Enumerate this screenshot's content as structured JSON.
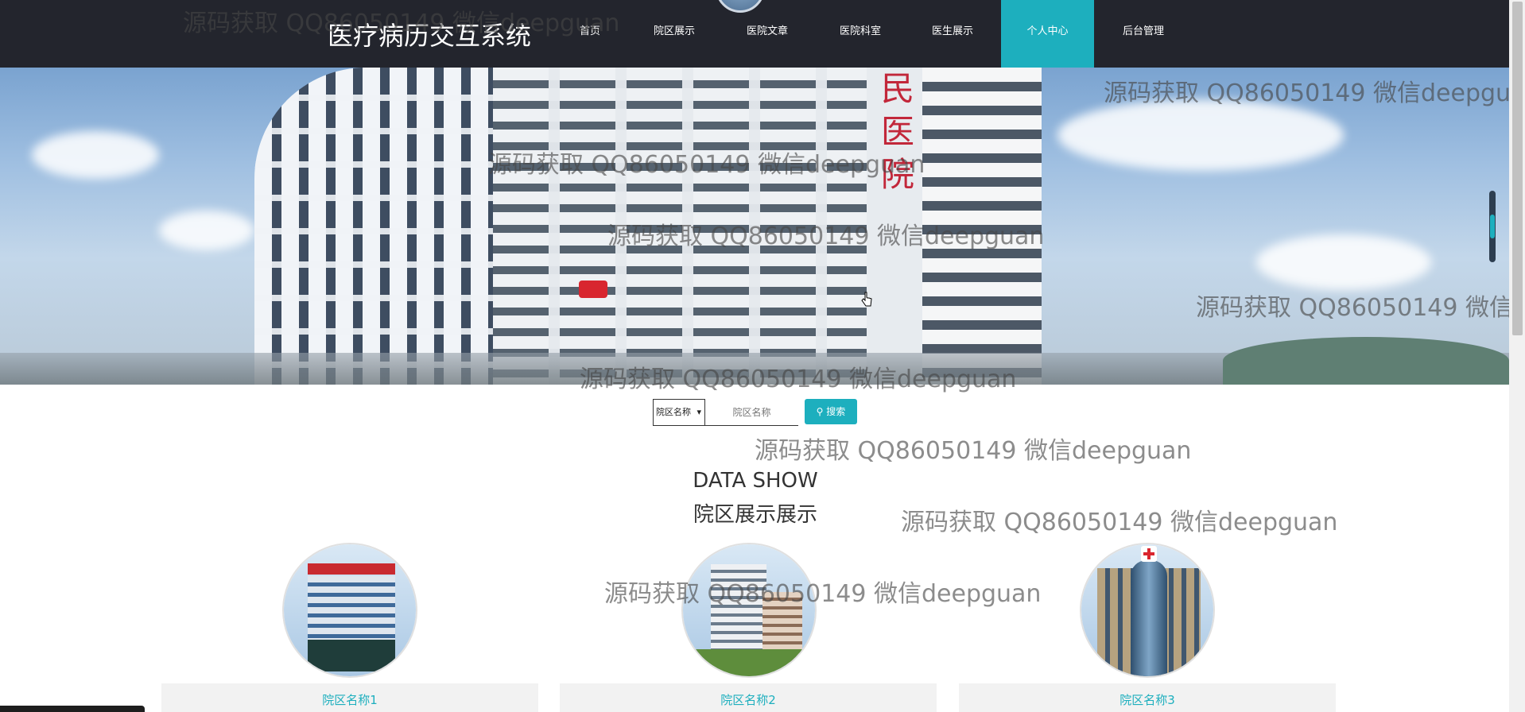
{
  "nav": {
    "site_title": "医疗病历交互系统",
    "items": [
      {
        "label": "首页"
      },
      {
        "label": "院区展示"
      },
      {
        "label": "医院文章"
      },
      {
        "label": "医院科室"
      },
      {
        "label": "医生展示"
      },
      {
        "label": "个人中心",
        "active": true
      },
      {
        "label": "后台管理"
      }
    ]
  },
  "hero": {
    "sign_text": "民医院"
  },
  "search": {
    "select_value": "院区名称",
    "input_placeholder": "院区名称",
    "button_label": "搜索"
  },
  "section": {
    "title_en": "DATA SHOW",
    "title_cn": "院区展示展示"
  },
  "cards": [
    {
      "name": "院区名称1"
    },
    {
      "name": "院区名称2"
    },
    {
      "name": "院区名称3"
    }
  ],
  "watermark": {
    "text": "源码获取 QQ86050149 微信deepguan",
    "text_cut": "源码获取 QQ86050149 微信de"
  },
  "colors": {
    "nav_bg": "#23252d",
    "accent": "#1dafbe"
  }
}
